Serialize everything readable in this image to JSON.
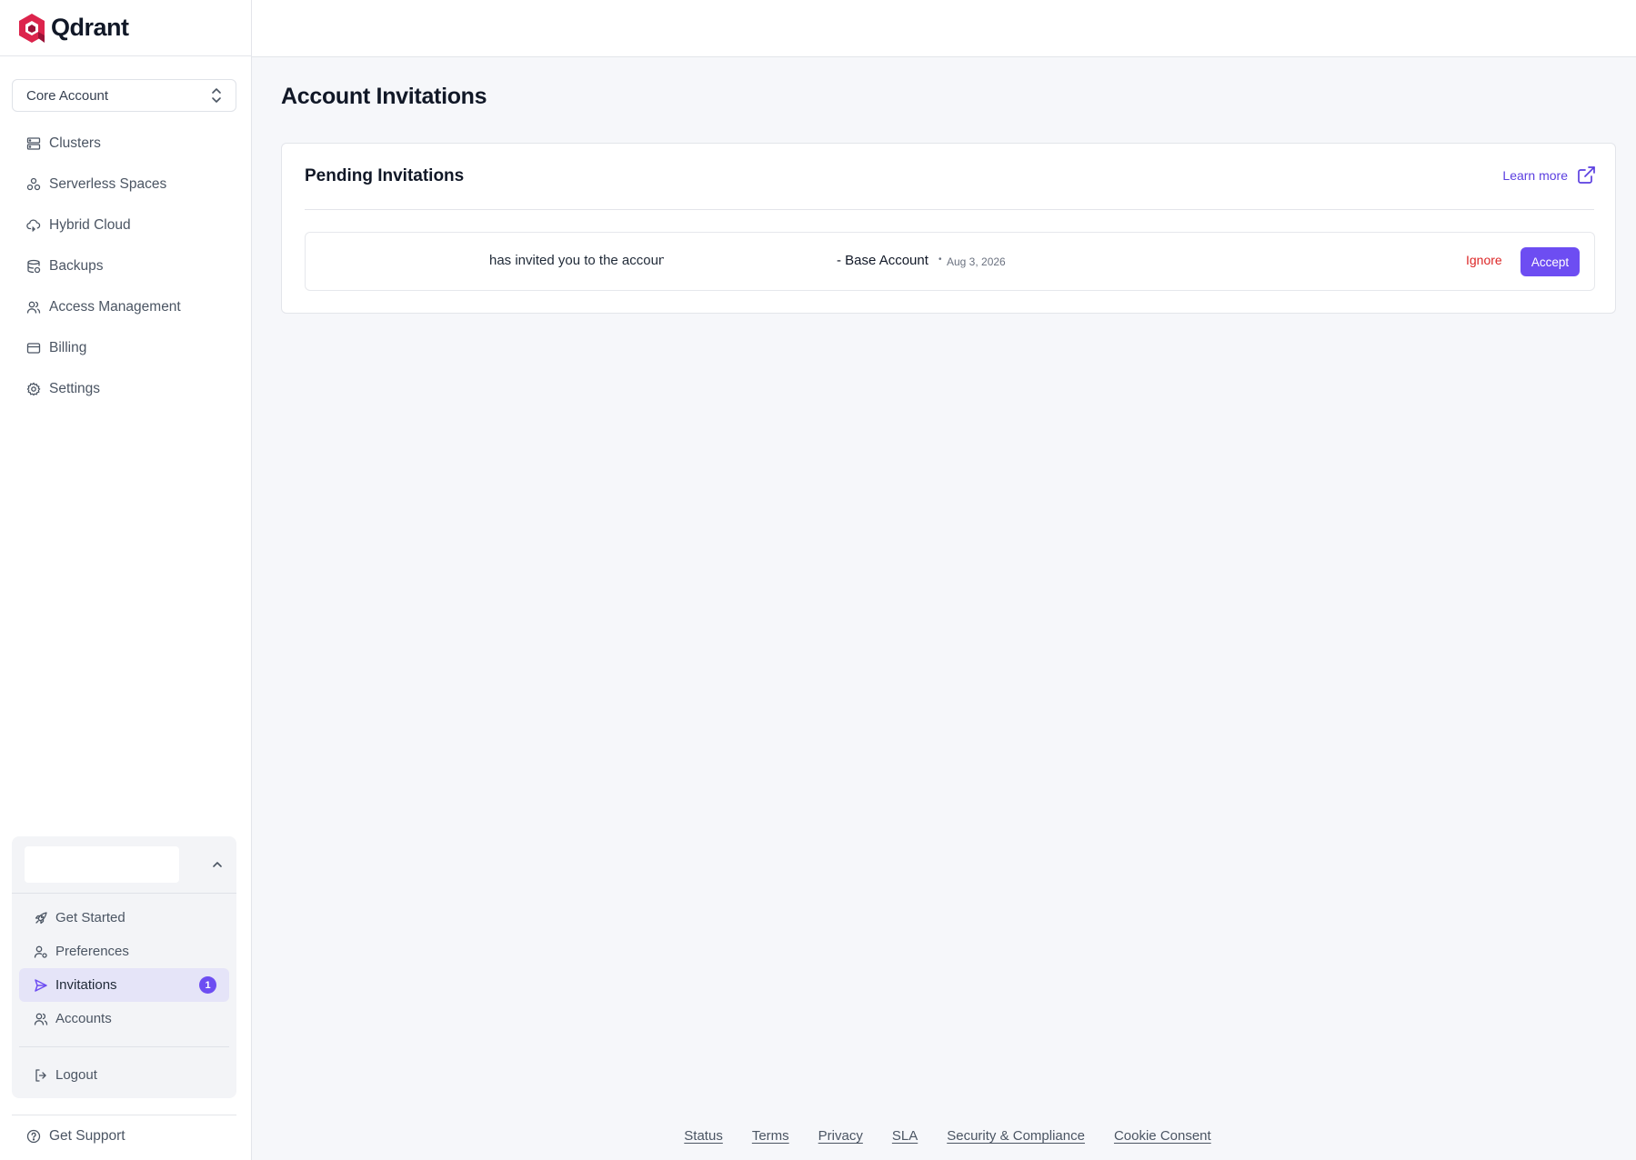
{
  "brand": {
    "name": "Qdrant",
    "logo_color": "#dc244c"
  },
  "account_selector": {
    "value": "Core Account"
  },
  "nav": [
    {
      "label": "Clusters",
      "icon": "server-icon"
    },
    {
      "label": "Serverless Spaces",
      "icon": "molecule-icon"
    },
    {
      "label": "Hybrid Cloud",
      "icon": "cloud-sync-icon"
    },
    {
      "label": "Backups",
      "icon": "database-backup-icon"
    },
    {
      "label": "Access Management",
      "icon": "users-icon"
    },
    {
      "label": "Billing",
      "icon": "credit-card-icon"
    },
    {
      "label": "Settings",
      "icon": "gear-icon"
    }
  ],
  "user_menu": {
    "items": [
      {
        "label": "Get Started",
        "icon": "rocket-icon"
      },
      {
        "label": "Preferences",
        "icon": "user-cog-icon"
      },
      {
        "label": "Invitations",
        "icon": "send-icon",
        "badge": "1",
        "active": true
      },
      {
        "label": "Accounts",
        "icon": "users-icon"
      }
    ],
    "logout": "Logout"
  },
  "support": {
    "label": "Get Support"
  },
  "main": {
    "title": "Account Invitations",
    "card": {
      "title": "Pending Invitations",
      "learn_more": "Learn more",
      "invitation": {
        "text": "has invited you to the account",
        "account": "- Base Account",
        "separator": "•",
        "date": "Aug 3, 2026",
        "ignore_label": "Ignore",
        "accept_label": "Accept"
      }
    }
  },
  "footer": {
    "links": [
      "Status",
      "Terms",
      "Privacy",
      "SLA",
      "Security & Compliance",
      "Cookie Consent"
    ]
  },
  "colors": {
    "accent": "#6d4df2",
    "danger": "#dc2626",
    "active_bg": "#e5e4f8"
  }
}
